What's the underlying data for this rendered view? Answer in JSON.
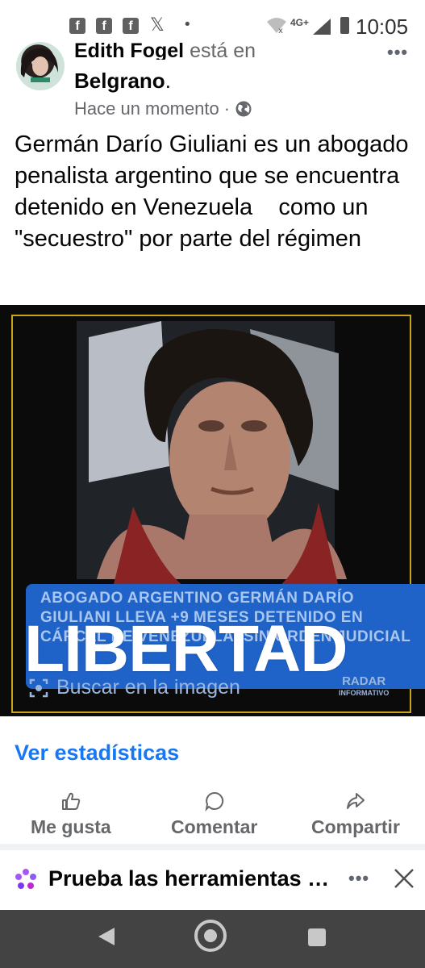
{
  "status_bar": {
    "app_icons": [
      "facebook-icon",
      "facebook-icon",
      "facebook-icon",
      "x-icon"
    ],
    "network_type": "4G+",
    "time": "10:05"
  },
  "post": {
    "author": "Edith Fogel",
    "verb": "está en",
    "place": "Belgrano",
    "place_suffix": ".",
    "timestamp": "Hace un momento",
    "separator": "·",
    "audience_icon": "globe-icon",
    "text": "Germán Darío Giuliani es un abogado penalista argentino que se encuentra detenido en Venezuela    como un \"secuestro\" por parte del régimen"
  },
  "image": {
    "banner_text": "ABOGADO ARGENTINO GERMÁN DARÍO GIULIANI LLEVA +9 MESES DETENIDO EN CÁRCEL DE VENEZUELA, SIN ORDEN JUDICIAL",
    "overlay_title": "LIBERTAD",
    "lens_label": "Buscar en la imagen",
    "watermark": "RADAR",
    "watermark_sub": "INFORMATIVO"
  },
  "stats_link": "Ver estadísticas",
  "actions": [
    {
      "label": "Me gusta",
      "icon": "thumbs-up-icon"
    },
    {
      "label": "Comentar",
      "icon": "comment-icon"
    },
    {
      "label": "Compartir",
      "icon": "share-icon"
    }
  ],
  "promo": {
    "text": "Prueba las herramientas de Meta Business Suite",
    "more": "•••"
  },
  "colors": {
    "accent": "#1877f2",
    "banner": "#1f63c9",
    "frame": "#c9a318",
    "navbar": "#434343"
  }
}
